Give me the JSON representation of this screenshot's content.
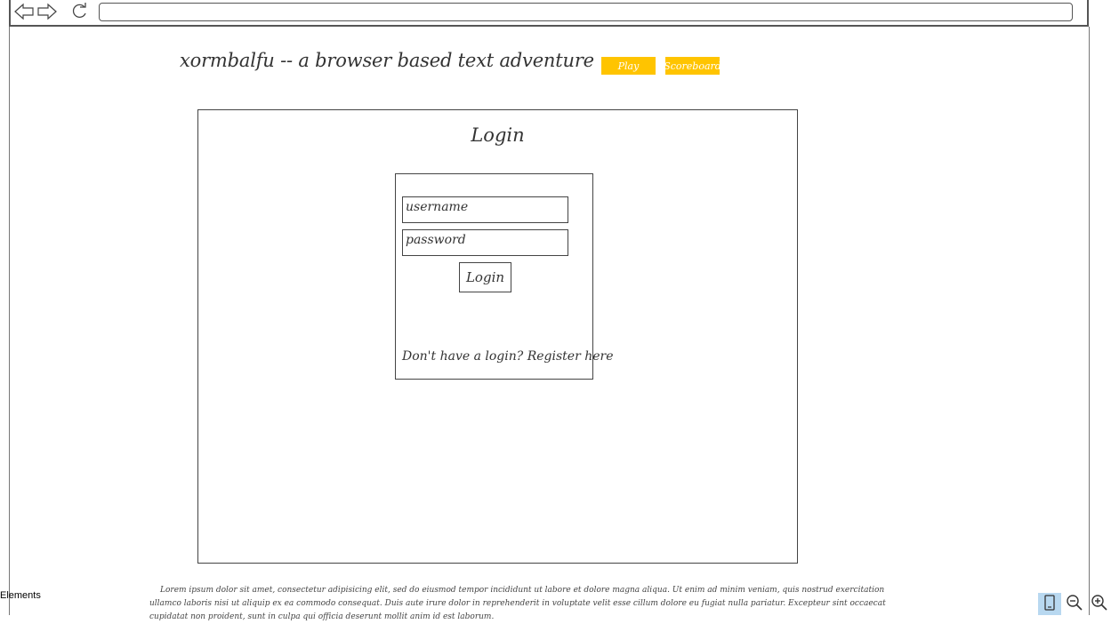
{
  "browser": {
    "icons": [
      "back-arrow-icon",
      "forward-arrow-icon",
      "reload-icon"
    ],
    "url": ""
  },
  "header": {
    "title": "xormbalfu -- a browser based text adventure",
    "nav": {
      "play_label": "Play",
      "scoreboard_label": "Scoreboard"
    },
    "accent_color": "#ffc400"
  },
  "login": {
    "heading": "Login",
    "username_placeholder": "username",
    "password_placeholder": "password",
    "button_label": "Login",
    "register_text": "Don't have a login? Register here"
  },
  "footer": {
    "lorem": "Lorem ipsum dolor sit amet, consectetur adipisicing elit, sed do eiusmod tempor incididunt ut labore et dolore magna aliqua. Ut enim ad minim veniam, quis nostrud exercitation ullamco laboris nisi ut aliquip ex ea commodo consequat. Duis aute irure dolor in reprehenderit in voluptate velit esse cillum dolore eu fugiat nulla pariatur. Excepteur sint occaecat cupidatat non proident, sunt in culpa qui officia deserunt mollit anim id est laborum."
  },
  "tool": {
    "elements_label": "Elements",
    "icons": [
      "device-icon",
      "zoom-out-icon",
      "zoom-in-icon"
    ]
  }
}
